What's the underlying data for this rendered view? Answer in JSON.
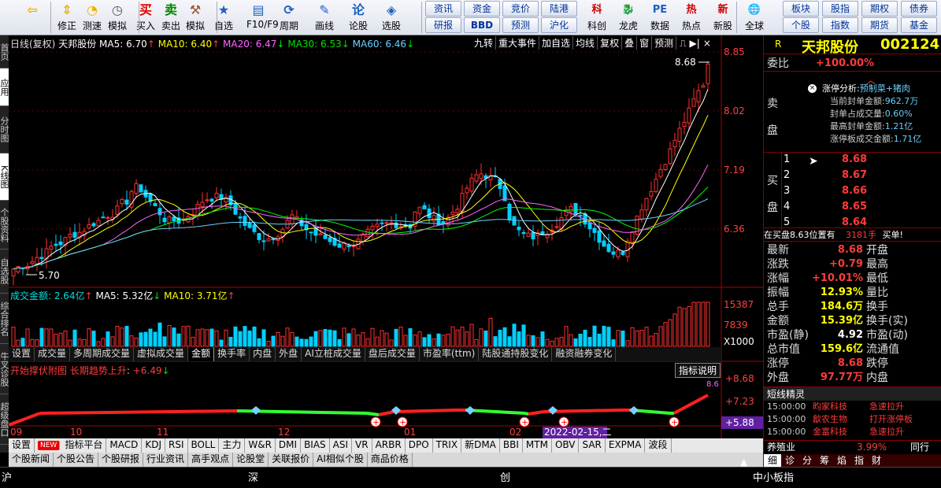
{
  "toolbar": {
    "left": [
      {
        "label": "",
        "icon": "back-arrow-icon"
      },
      {
        "label": "修正",
        "icon": "up-down-arrows-icon"
      },
      {
        "label": "测速",
        "icon": "speed-icon"
      },
      {
        "label": "模拟",
        "icon": "clock-icon"
      },
      {
        "label": "买入",
        "icon": "buy-icon"
      },
      {
        "label": "卖出",
        "icon": "sell-icon"
      },
      {
        "label": "模拟",
        "icon": "hammer-icon"
      },
      {
        "label": "自选",
        "icon": "star-icon"
      },
      {
        "label": "F10/F9",
        "icon": "f10-icon"
      },
      {
        "label": "周期",
        "icon": "period-icon"
      },
      {
        "label": "画线",
        "icon": "pencil-icon"
      },
      {
        "label": "论股",
        "icon": "chat-icon"
      },
      {
        "label": "选股",
        "icon": "select-icon"
      }
    ],
    "mid_top": [
      "资讯",
      "资金",
      "竞价",
      "陆港"
    ],
    "mid_bot": [
      "研报",
      "BBD",
      "预测",
      "沪化"
    ],
    "right_icons": [
      {
        "label": "科创",
        "icon": "science-icon"
      },
      {
        "label": "龙虎",
        "icon": "dragon-icon"
      },
      {
        "label": "数据",
        "icon": "pe-icon"
      },
      {
        "label": "热点",
        "icon": "hot-icon"
      },
      {
        "label": "新股",
        "icon": "new-stock-icon"
      },
      {
        "label": "全球",
        "icon": "globe-icon"
      }
    ],
    "far_top": [
      "板块",
      "股指",
      "期权",
      "债券"
    ],
    "far_bot": [
      "个股",
      "指数",
      "期货",
      "基金"
    ]
  },
  "vtabs": [
    {
      "label": "首页",
      "on": false
    },
    {
      "label": "应用",
      "on": true
    },
    {
      "label": "分时图",
      "on": false
    },
    {
      "label": "K线图",
      "on": true
    },
    {
      "label": "个股资料",
      "on": false
    },
    {
      "label": "自选股",
      "on": false
    },
    {
      "label": "综合排名",
      "on": false
    },
    {
      "label": "牛叉诊股",
      "on": false
    },
    {
      "label": "超级盘口",
      "on": false
    }
  ],
  "kline": {
    "title": "日线(复权)",
    "name": "天邦股份",
    "ma5": "MA5: 6.70",
    "ma10": "MA10: 6.40",
    "ma20": "MA20: 6.47",
    "ma30": "MA30: 6.53",
    "ma60": "MA60: 6.46",
    "right_btns": [
      "九转",
      "重大事件",
      "加自选",
      "均线",
      "复权",
      "叠",
      "窗",
      "预测"
    ],
    "yticks": [
      "8.85",
      "8.02",
      "7.19",
      "6.36"
    ],
    "high": "8.68",
    "low": "5.70"
  },
  "volume": {
    "title": "成交金额: 2.64亿",
    "ma5": "MA5: 5.32亿",
    "ma10": "MA10: 3.71亿",
    "yticks": [
      "15387",
      "7839",
      "X1000"
    ]
  },
  "subtabs": [
    "设置",
    "成交量",
    "多周期成交量",
    "虚拟成交量",
    "金额",
    "换手率",
    "内盘",
    "外盘",
    "AI立桩成交量",
    "盘后成交量",
    "市盈率(ttm)",
    "陆股通持股变化",
    "融资融券变化"
  ],
  "indicator": {
    "title": "开始撑伏附图 长期趋势上升",
    "value": "+6.49",
    "btn": "指标说明",
    "yticks": [
      "+8.68",
      "+7.23",
      "+5.88"
    ],
    "topval": "8.6"
  },
  "xaxis": [
    "09",
    "10",
    "11",
    "12",
    "01",
    "02"
  ],
  "xaxis_date": "2022-02-15,二",
  "bottom_tabs": [
    "设置",
    "NEW",
    "指标平台",
    "MACD",
    "KDJ",
    "RSI",
    "BOLL",
    "主力",
    "W&R",
    "DMI",
    "BIAS",
    "ASI",
    "VR",
    "ARBR",
    "DPO",
    "TRIX",
    "新DMA",
    "BBI",
    "MTM",
    "OBV",
    "SAR",
    "EXPMA",
    "波段"
  ],
  "news_tabs": [
    "个股新闻",
    "个股公告",
    "个股研报",
    "行业资讯",
    "高手观点",
    "论股堂",
    "关联报价",
    "AI相似个股",
    "商品价格"
  ],
  "quote": {
    "code_tag": "R",
    "stock": "天邦股份",
    "code": "002124",
    "weibi_label": "委比",
    "weibi": "+100.00%",
    "sell_label": "卖盘",
    "zt": {
      "title": "涨停分析:",
      "tag": "预制菜+猪肉",
      "lines": [
        [
          "当前封单金额:",
          "962.7万"
        ],
        [
          "封单占成交量:",
          "0.60%"
        ],
        [
          "最高封单金额:",
          "1.21亿"
        ],
        [
          "涨停板成交金额:",
          "1.71亿"
        ]
      ]
    },
    "buy_label": "买盘",
    "buys": [
      [
        "1",
        "8.68"
      ],
      [
        "2",
        "8.67"
      ],
      [
        "3",
        "8.66"
      ],
      [
        "4",
        "8.65"
      ],
      [
        "5",
        "8.64"
      ]
    ],
    "inbuy": "在买盘8.63位置有",
    "inbuy_vol": "3181手",
    "inbuy_tail": "买单!",
    "stats": [
      [
        "最新",
        "8.68",
        "开盘",
        ""
      ],
      [
        "涨跌",
        "+0.79",
        "最高",
        ""
      ],
      [
        "涨幅",
        "+10.01%",
        "最低",
        ""
      ],
      [
        "振幅",
        "12.93%",
        "量比",
        ""
      ],
      [
        "总手",
        "184.6万",
        "换手",
        ""
      ],
      [
        "金额",
        "15.39亿",
        "换手(实)",
        ""
      ],
      [
        "市盈(静)",
        "4.92",
        "市盈(动)",
        ""
      ],
      [
        "总市值",
        "159.6亿",
        "流通值",
        ""
      ],
      [
        "涨停",
        "8.68",
        "跌停",
        ""
      ],
      [
        "外盘",
        "97.77万",
        "内盘",
        ""
      ]
    ],
    "dxjl": "短线精灵",
    "events": [
      [
        "15:00:00",
        "昀家科技",
        "急速拉升"
      ],
      [
        "15:00:00",
        "歙农生物",
        "打开涨停板"
      ],
      [
        "15:00:00",
        "金富科技",
        "急速拉升"
      ]
    ],
    "ind_name": "养殖业",
    "ind_pct": "3.99%",
    "ind_right": "同行",
    "tabs": [
      "细",
      "诊",
      "分",
      "筹",
      "焰",
      "指",
      "财"
    ]
  },
  "status": {
    "items": [
      "沪",
      "深",
      "创",
      "中小板指"
    ]
  }
}
